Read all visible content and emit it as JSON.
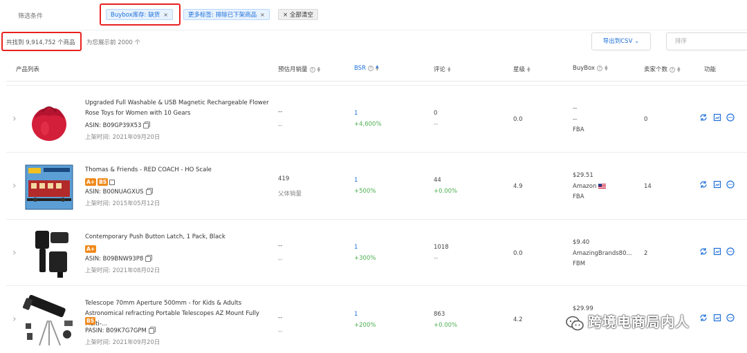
{
  "filters": {
    "label": "筛选条件",
    "chips": [
      {
        "text": "Buybox库存: 缺货",
        "close": "×"
      },
      {
        "text": "更多标签: 排除已下架商品",
        "close": "×"
      }
    ],
    "clear_all": "× 全部清空"
  },
  "summary": {
    "count": "共找到 9,914,752 个商品",
    "note": "为您展示前 2000 个"
  },
  "toolbar": {
    "export_label": "导出到CSV",
    "sort_placeholder": "排序"
  },
  "table": {
    "headers": {
      "product_list": "产品列表",
      "monthly_sales": "预估月销量",
      "bsr": "BSR",
      "reviews": "评论",
      "rating": "星级",
      "buybox": "BuyBox",
      "sellers": "卖家个数",
      "actions": "功能"
    },
    "rows": [
      {
        "title": "Upgraded Full Washable & USB Magnetic Rechargeable Flower Rose Toys for Women with 10 Gears",
        "badges": [],
        "asin": "ASIN: B09GP39X53",
        "listed": "上架时间: 2021年09月20日",
        "sales": "--",
        "sales_sub": "--",
        "bsr": "1",
        "bsr_change": "+4,600%",
        "reviews": "0",
        "reviews_change": "--",
        "rating": "0.0",
        "buybox_price": "--",
        "buybox_seller": "--",
        "buybox_fulfill": "FBA",
        "sellers": "0"
      },
      {
        "title": "Thomas & Friends - RED COACH - HO Scale",
        "badges": [
          "A+",
          "BS"
        ],
        "asin": "ASIN: B00NUAGXUS",
        "listed": "上架时间: 2015年05月12日",
        "sales": "419",
        "sales_sub": "父体销量",
        "bsr": "1",
        "bsr_change": "+500%",
        "reviews": "44",
        "reviews_change": "+0.00%",
        "rating": "4.9",
        "buybox_price": "$29.51",
        "buybox_seller": "Amazon",
        "buybox_fulfill": "FBA",
        "sellers": "14"
      },
      {
        "title": "Contemporary Push Button Latch, 1 Pack, Black",
        "badges": [
          "A+"
        ],
        "asin": "ASIN: B09BNW93P8",
        "listed": "上架时间: 2021年08月02日",
        "sales": "--",
        "sales_sub": "--",
        "bsr": "1",
        "bsr_change": "+300%",
        "reviews": "1018",
        "reviews_change": "--",
        "rating": "0.0",
        "buybox_price": "$9.40",
        "buybox_seller": "AmazingBrands80...",
        "buybox_fulfill": "FBM",
        "sellers": "2"
      },
      {
        "title": "Telescope 70mm Aperture 500mm - for Kids & Adults Astronomical refracting Portable Telescopes AZ Mount Fully Multi-...",
        "badges": [
          "BS"
        ],
        "asin": "PASIN: B09K7G7GPM",
        "listed": "上架时间: 2021年09月20日",
        "sales": "--",
        "sales_sub": "--",
        "bsr": "1",
        "bsr_change": "+200%",
        "reviews": "863",
        "reviews_change": "+0.00%",
        "rating": "4.2",
        "buybox_price": "$29.99",
        "buybox_seller": "",
        "buybox_fulfill": "",
        "sellers": ""
      }
    ]
  },
  "watermark": "跨境电商局内人",
  "colors": {
    "accent": "#1d6fd8",
    "positive": "#4caf50",
    "badge": "#f08a1c",
    "highlight": "#e8201e"
  }
}
